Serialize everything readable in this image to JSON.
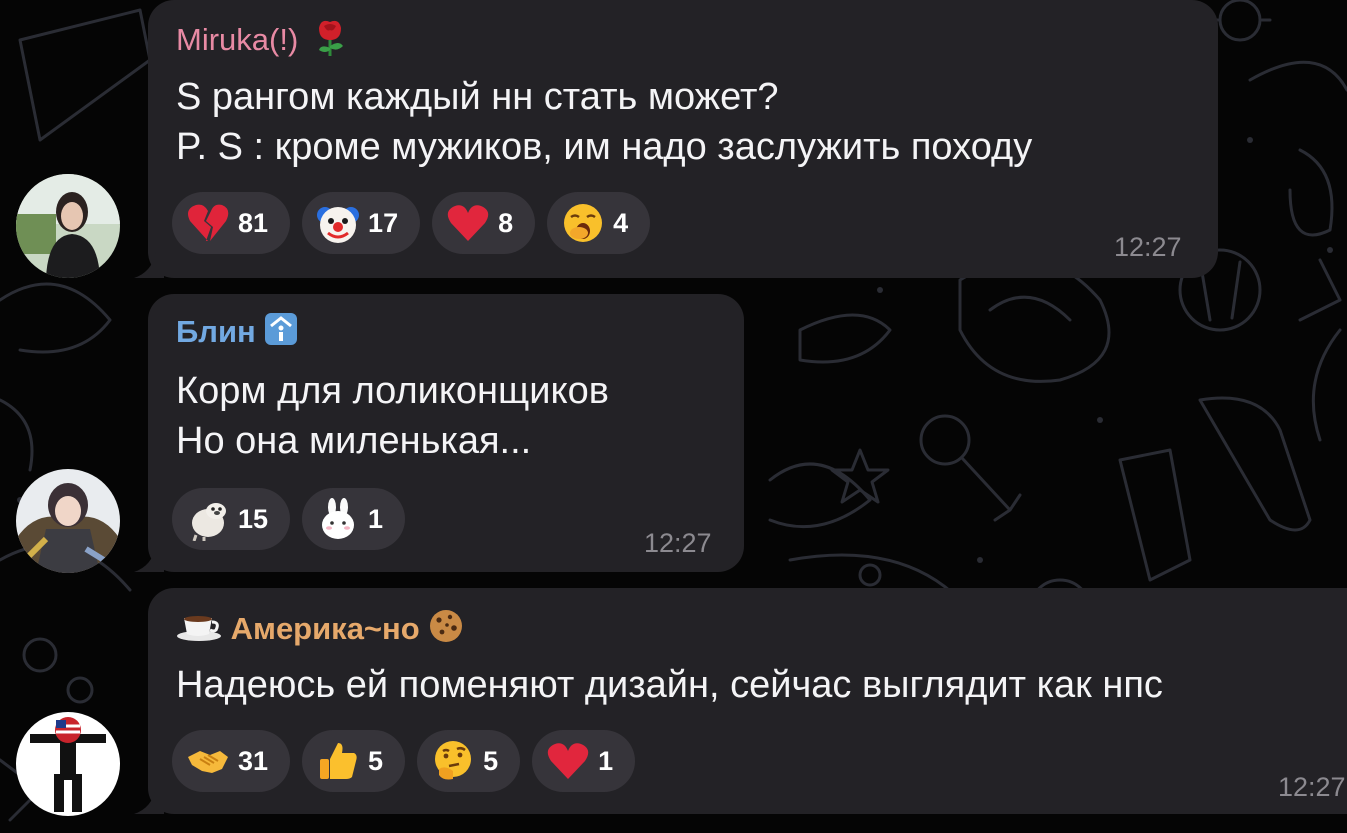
{
  "colors": {
    "background": "#050505",
    "bubble": "#232226",
    "reaction_pill": "#36343a",
    "message_text": "#f4f4f6",
    "timestamp": "#8c8a90"
  },
  "messages": [
    {
      "sender": "Miruka(!)",
      "sender_color": "#e88aa4",
      "sender_badge_icon": "rose-icon",
      "lines": [
        "S рангом каждый нн стать может?",
        "P. S : кроме мужиков, им надо заслужить походу"
      ],
      "reactions": [
        {
          "icon": "broken-heart-icon",
          "count": "81"
        },
        {
          "icon": "clown-face-icon",
          "count": "17"
        },
        {
          "icon": "red-heart-icon",
          "count": "8"
        },
        {
          "icon": "yawning-face-icon",
          "count": "4"
        }
      ],
      "time": "12:27"
    },
    {
      "sender": "Блин",
      "sender_color": "#72a9e2",
      "sender_badge_icon": "info-badge-icon",
      "lines": [
        "Корм для лоликонщиков",
        "Но она миленькая..."
      ],
      "reactions": [
        {
          "icon": "seal-sticker-icon",
          "count": "15"
        },
        {
          "icon": "bunny-sticker-icon",
          "count": "1"
        }
      ],
      "time": "12:27"
    },
    {
      "sender": "Америка~но",
      "sender_color": "#e6a96b",
      "sender_prefix_icon": "coffee-cup-icon",
      "sender_badge_icon": "cookie-icon",
      "lines": [
        "Надеюсь ей поменяют дизайн, сейчас выглядит как нпс"
      ],
      "reactions": [
        {
          "icon": "handshake-icon",
          "count": "31"
        },
        {
          "icon": "thumbs-up-icon",
          "count": "5"
        },
        {
          "icon": "thinking-face-icon",
          "count": "5"
        },
        {
          "icon": "red-heart-icon",
          "count": "1"
        }
      ],
      "time": "12:27"
    }
  ]
}
